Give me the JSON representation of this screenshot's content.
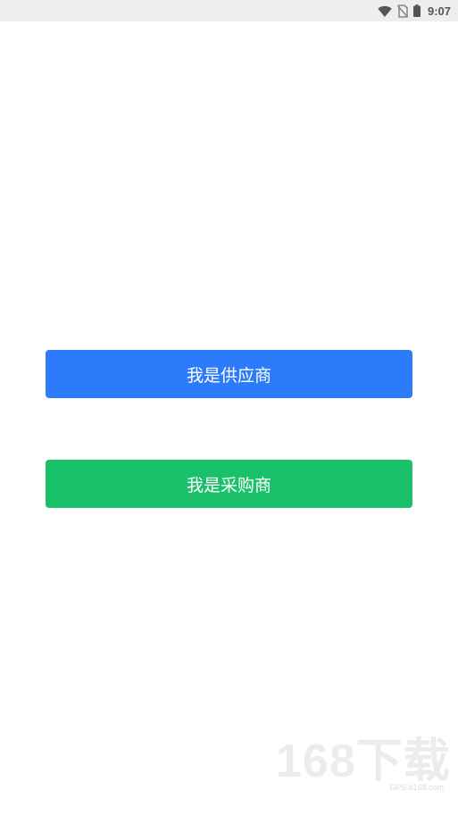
{
  "status_bar": {
    "time": "9:07",
    "icons": [
      "wifi-icon",
      "no-sim-icon",
      "battery-icon"
    ]
  },
  "actions": {
    "supplier_label": "我是供应商",
    "buyer_label": "我是采购商"
  },
  "watermark": {
    "text": "168下载",
    "url": "GPS.it168.com"
  },
  "colors": {
    "supplier": "#2b7bfa",
    "buyer": "#1bc06a",
    "status_bar_bg": "#eeeeee"
  }
}
